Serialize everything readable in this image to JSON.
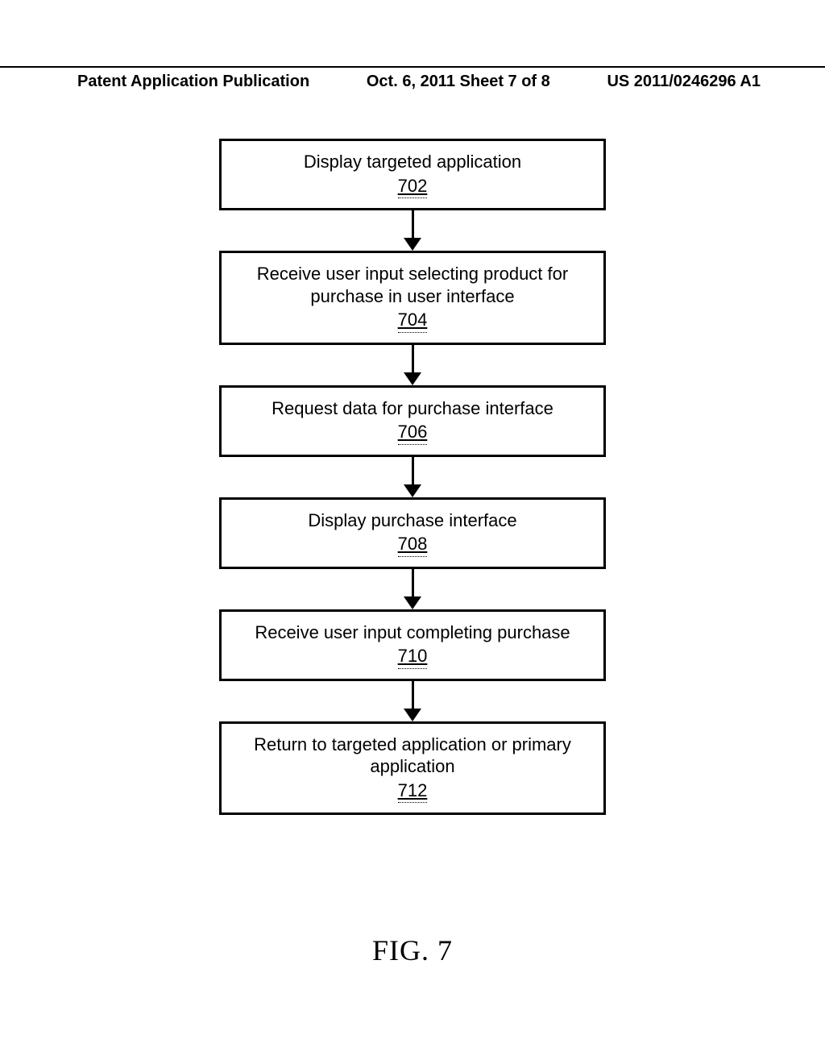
{
  "header": {
    "left": "Patent Application Publication",
    "center": "Oct. 6, 2011  Sheet 7 of 8",
    "right": "US 2011/0246296 A1"
  },
  "steps": [
    {
      "text": "Display targeted application",
      "ref": "702"
    },
    {
      "text": "Receive user input selecting product for purchase in user interface",
      "ref": "704"
    },
    {
      "text": "Request data for purchase interface",
      "ref": "706"
    },
    {
      "text": "Display purchase interface",
      "ref": "708"
    },
    {
      "text": "Receive user input completing purchase",
      "ref": "710"
    },
    {
      "text": "Return to targeted application or primary application",
      "ref": "712"
    }
  ],
  "figure_label": "FIG. 7"
}
